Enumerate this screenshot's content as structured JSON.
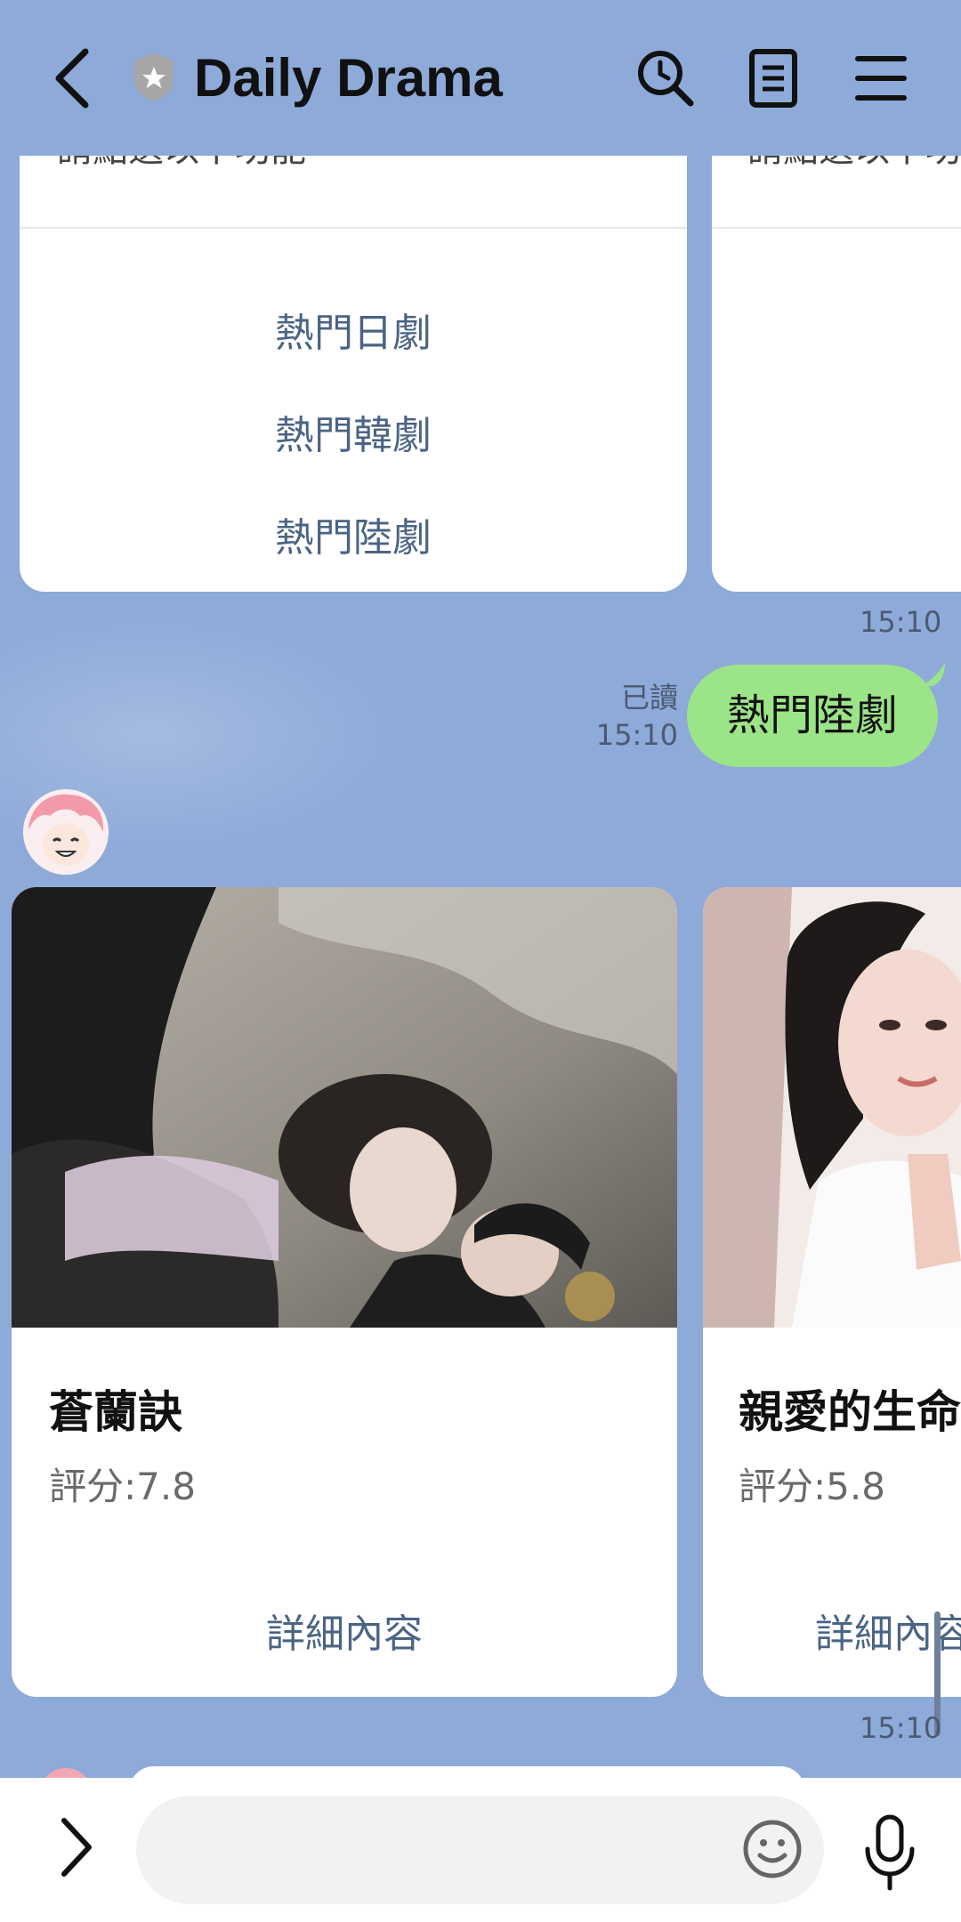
{
  "header": {
    "title": "Daily Drama",
    "back_icon": "back-chevron-icon",
    "shield_icon": "shield-star-icon",
    "actions": [
      "search-icon",
      "notes-icon",
      "menu-icon"
    ]
  },
  "menu_card": {
    "cut_text": "請點選以下功能",
    "items": [
      "熱門日劇",
      "熱門韓劇",
      "熱門陸劇"
    ]
  },
  "menu_card_2": {
    "cut_text": "請點選以下功"
  },
  "timestamps": {
    "t1": "15:10",
    "t2": "15:10",
    "t3": "15:10"
  },
  "my_message": {
    "text": "熱門陸劇",
    "read": "已讀"
  },
  "dramas": [
    {
      "title": "蒼蘭訣",
      "rating": "評分:7.8",
      "link": "詳細內容"
    },
    {
      "title": "親愛的生命",
      "rating": "評分:5.8",
      "link": "詳細內容"
    }
  ],
  "input": {
    "placeholder": ""
  },
  "colors": {
    "background": "#8eaad9",
    "my_bubble": "#9ce488",
    "link": "#4a6485"
  }
}
